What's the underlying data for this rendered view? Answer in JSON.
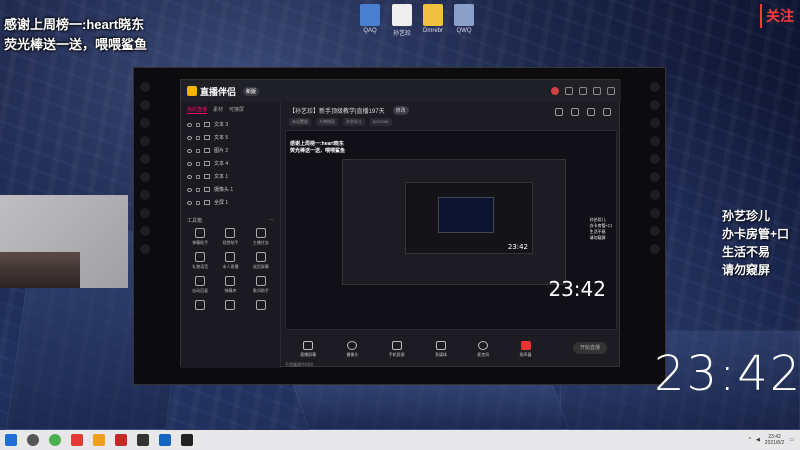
{
  "desktop": {
    "icons": [
      {
        "label": "QAQ",
        "color": "#4a7fd0"
      },
      {
        "label": "孙艺珍",
        "color": "#eeeeee"
      },
      {
        "label": "Dmrebr",
        "color": "#f0c040"
      },
      {
        "label": "QWQ",
        "color": "#8aa0c8"
      }
    ]
  },
  "overlay": {
    "line1": "感谢上周榜一:heart晓东",
    "line2": "荧光棒送一送，喂喂鲨鱼",
    "watermark": "5222186",
    "follow_label": "关注",
    "right_lines": [
      "孙艺珍儿",
      "办卡房管+口",
      "生活不易",
      "请勿窥屏"
    ],
    "clock": "23:42"
  },
  "app": {
    "name": "直播伴侣",
    "version": "新版",
    "tabs": [
      "我的直播",
      "素材",
      "可接屏"
    ],
    "active_tab": "我的直播",
    "sources": [
      {
        "label": "文本 3"
      },
      {
        "label": "文本 5"
      },
      {
        "label": "图片 2"
      },
      {
        "label": "文本 4"
      },
      {
        "label": "文本 1"
      },
      {
        "label": "摄像头 1"
      },
      {
        "label": "全屏 1"
      }
    ],
    "tools_title": "工具箱",
    "tools": [
      "弹幕助手",
      "观赏助手",
      "主播任务",
      "礼物语音",
      "本人直播",
      "送货屏幕",
      "自动回复",
      "弹幕库",
      "歌词助手",
      "",
      "",
      ""
    ],
    "stream_title": "【孙艺珍】新手顶级教学|直播197天",
    "stream_title_tag": "修改",
    "meta": [
      "未设置图",
      "大神指导",
      "孙艺珍儿",
      "5222186"
    ],
    "preview": {
      "line1": "感谢上周榜一:heart晓东",
      "line2": "荧光棒送一送，喂喂鲨鱼",
      "clock": "23:42",
      "side_lines": [
        "孙艺珍儿",
        "办卡房管+口",
        "生活不易",
        "请勿窥屏"
      ]
    },
    "bottom_buttons": [
      {
        "label": "直播屏幕",
        "icon": "screen-icon"
      },
      {
        "label": "摄像头",
        "icon": "camera-icon"
      },
      {
        "label": "手机投屏",
        "icon": "phone-icon"
      },
      {
        "label": "多媒体",
        "icon": "media-icon"
      },
      {
        "label": "麦克风",
        "icon": "mic-icon"
      },
      {
        "label": "扬声器",
        "icon": "speaker-icon"
      }
    ],
    "start_label": "开始直播",
    "status": "不透露操作时间",
    "accent": "#ff2d55"
  },
  "taskbar": {
    "time": "23:42",
    "date": "2021/8/2"
  }
}
